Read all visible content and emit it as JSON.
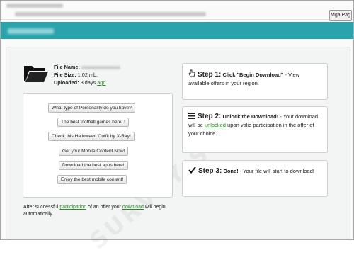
{
  "browser": {
    "lang_button": "Mga Pag"
  },
  "file": {
    "name_label": "File Name:",
    "size_label": "File Size:",
    "size_value": "1.02 mb.",
    "uploaded_label": "Uploaded:",
    "uploaded_value": "3 days",
    "uploaded_link": "ago"
  },
  "offers": [
    "What type of Personality do you have?",
    "The best football games here! !",
    "Check this Halloween Outfit by X-Ray!",
    "Get your Mobile Content Now!",
    "Download the best apps here!",
    "Enjoy the best mobile content!"
  ],
  "footer": {
    "part1": "After successful ",
    "link1": "participation",
    "part2": " of an offer your ",
    "link2": "download",
    "part3": " will begin automatically."
  },
  "steps": {
    "step1": {
      "title": "Step 1:",
      "strong": "Click \"Begin Download\"",
      "text": " - View available offers in your region."
    },
    "step2": {
      "title": "Step 2:",
      "strong": "Unlock the Download!",
      "text1": " - Your download will be ",
      "link": "unlocked",
      "text2": " upon valid participation in the offer of your choice."
    },
    "step3": {
      "title": "Step 3:",
      "strong": "Done!",
      "text": " - Your file will start to download!"
    }
  },
  "watermark": "SURVEY SITE",
  "colors": {
    "header": "#2aa3ad",
    "link_green": "#2a8a2a"
  },
  "icons": [
    "folder-icon",
    "hand-pointer-icon",
    "list-icon",
    "checkmark-icon"
  ]
}
